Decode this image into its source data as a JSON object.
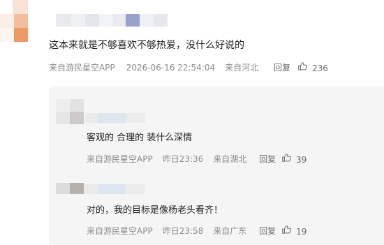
{
  "comment": {
    "text": "这本来就是不够喜欢不够热爱，没什么好说的",
    "source": "来自游民星空APP",
    "timestamp": "2026-06-16 22:54:04",
    "location": "来自河北",
    "reply_label": "回复",
    "likes": "236"
  },
  "replies": [
    {
      "text": "客观的 合理的 装什么深情",
      "source": "来自游民星空APP",
      "timestamp": "昨日23:36",
      "location": "来自湖北",
      "reply_label": "回复",
      "likes": "39"
    },
    {
      "text": "对的，我的目标是像杨老头看齐！",
      "source": "来自游民星空APP",
      "timestamp": "昨日23:58",
      "location": "来自广东",
      "reply_label": "回复",
      "likes": "19"
    }
  ],
  "icons": {
    "like": "thumbs-up-icon"
  },
  "colors": {
    "meta_text": "#8c8c8c",
    "panel_bg": "#f5f5f5"
  }
}
